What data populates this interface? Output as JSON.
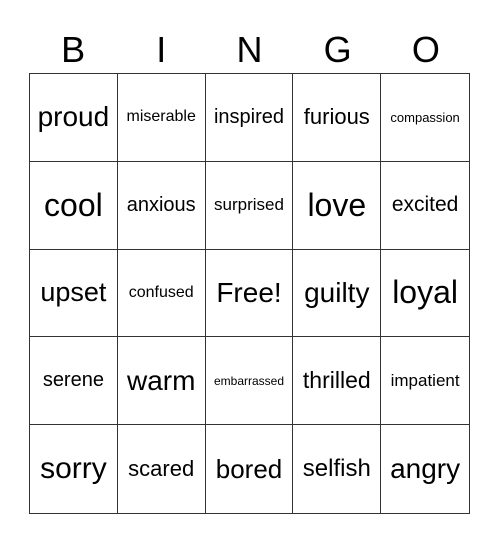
{
  "header": [
    "B",
    "I",
    "N",
    "G",
    "O"
  ],
  "cells": [
    "proud",
    "miserable",
    "inspired",
    "furious",
    "compassion",
    "cool",
    "anxious",
    "surprised",
    "love",
    "excited",
    "upset",
    "confused",
    "Free!",
    "guilty",
    "loyal",
    "serene",
    "warm",
    "embarrassed",
    "thrilled",
    "impatient",
    "sorry",
    "scared",
    "bored",
    "selfish",
    "angry"
  ]
}
